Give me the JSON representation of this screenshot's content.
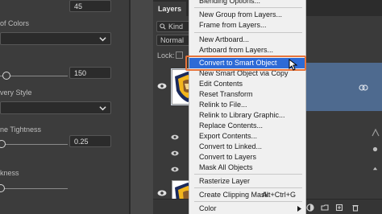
{
  "properties": {
    "fields": [
      {
        "label": "",
        "value": "45"
      },
      {
        "label": "of Colors",
        "value": ""
      },
      {
        "label": "",
        "value": "150"
      },
      {
        "label": "very Style",
        "value": ""
      },
      {
        "label": "ne Tightness",
        "value": "0.25"
      },
      {
        "label": "kness",
        "value": ""
      }
    ]
  },
  "layers_panel": {
    "tabs": [
      "Layers",
      "Ch"
    ],
    "filter_kind": "Kind",
    "blend_mode": "Normal",
    "lock_label": "Lock:"
  },
  "context_menu": {
    "items": [
      {
        "label": "Blending Options..."
      },
      {
        "label": "New Group from Layers..."
      },
      {
        "label": "Frame from Layers..."
      },
      {
        "label": "New Artboard..."
      },
      {
        "label": "Artboard from Layers..."
      },
      {
        "label": "Convert to Smart Object",
        "highlighted": true
      },
      {
        "label": "New Smart Object via Copy"
      },
      {
        "label": "Edit Contents"
      },
      {
        "label": "Reset Transform"
      },
      {
        "label": "Relink to File..."
      },
      {
        "label": "Relink to Library Graphic..."
      },
      {
        "label": "Replace Contents..."
      },
      {
        "label": "Export Contents..."
      },
      {
        "label": "Convert to Linked..."
      },
      {
        "label": "Convert to Layers"
      },
      {
        "label": "Mask All Objects"
      },
      {
        "label": "Rasterize Layer"
      },
      {
        "label": "Create Clipping Mask",
        "shortcut": "Alt+Ctrl+G"
      },
      {
        "label": "Color",
        "submenu": true
      }
    ]
  },
  "colors": {
    "highlight": "#2d6ad6",
    "focus_outline": "#e8743b",
    "selected_layer": "#4e6a8f"
  }
}
